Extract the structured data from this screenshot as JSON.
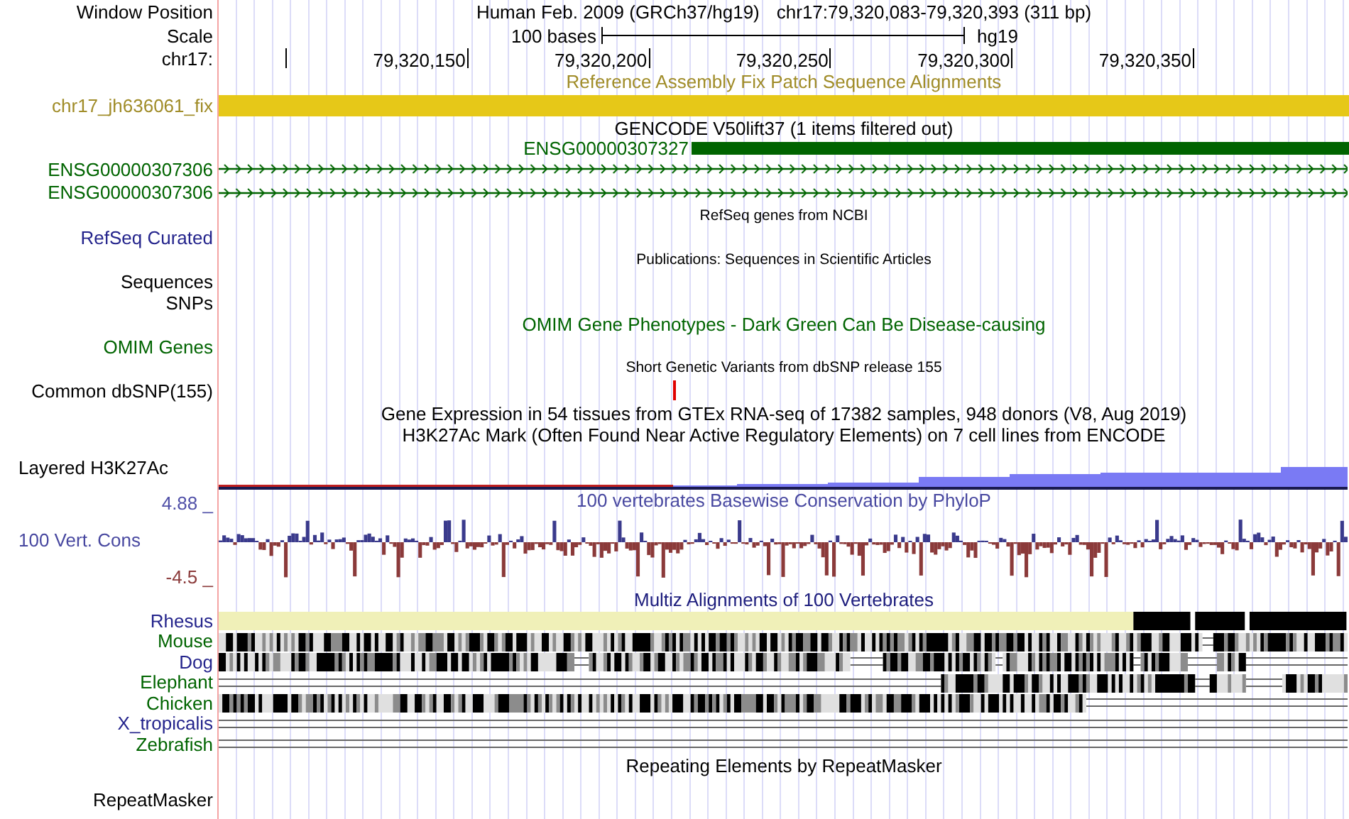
{
  "header": {
    "label": "Window Position",
    "assembly": "Human Feb. 2009 (GRCh37/hg19)",
    "position": "chr17:79,320,083-79,320,393 (311 bp)"
  },
  "scale": {
    "label": "Scale",
    "length": "100 bases",
    "assembly": "hg19"
  },
  "ruler": {
    "label": "chr17:",
    "ticks": [
      "79,320,150",
      "79,320,200",
      "79,320,250",
      "79,320,300",
      "79,320,350"
    ]
  },
  "tracks": [
    {
      "kind": "title",
      "text": "Reference Assembly Fix Patch Sequence Alignments",
      "color": "#a08c28"
    },
    {
      "kind": "fix_bar",
      "label": "chr17_jh636061_fix",
      "color": "#a08c28"
    },
    {
      "kind": "title",
      "text": "GENCODE V50lift37 (1 items filtered out)",
      "color": "#000000"
    },
    {
      "kind": "gene",
      "text": "ENSG00000307327",
      "color": "#006400"
    },
    {
      "kind": "arrows",
      "label": "ENSG00000307306",
      "color": "#006400"
    },
    {
      "kind": "arrows",
      "label": "ENSG00000307306",
      "color": "#006400"
    },
    {
      "kind": "note",
      "text": "RefSeq genes from NCBI",
      "color": "#000000"
    },
    {
      "kind": "label",
      "label": "RefSeq Curated",
      "color": "#24248c"
    },
    {
      "kind": "note",
      "text": "Publications: Sequences in Scientific Articles",
      "color": "#000000"
    },
    {
      "kind": "label",
      "label": "Sequences",
      "color": "#000000"
    },
    {
      "kind": "label",
      "label": "SNPs",
      "color": "#000000"
    },
    {
      "kind": "title",
      "text": "OMIM Gene Phenotypes - Dark Green Can Be Disease-causing",
      "color": "#006400"
    },
    {
      "kind": "label",
      "label": "OMIM Genes",
      "color": "#006400"
    },
    {
      "kind": "note",
      "text": "Short Genetic Variants from dbSNP release 155",
      "color": "#000000"
    },
    {
      "kind": "snp",
      "label": "Common dbSNP(155)",
      "color": "#000000"
    },
    {
      "kind": "title",
      "text": "Gene Expression in 54 tissues from GTEx RNA-seq of 17382 samples, 948 donors (V8, Aug 2019)",
      "color": "#000000"
    },
    {
      "kind": "title",
      "text": "H3K27Ac Mark (Often Found Near Active Regulatory Elements) on 7 cell lines from ENCODE",
      "color": "#000000"
    },
    {
      "kind": "layered",
      "label": "Layered H3K27Ac",
      "color": "#000000"
    },
    {
      "kind": "phylop",
      "label": "100 Vert. Cons",
      "max": "4.88 _",
      "min": "-4.5 _",
      "text": "100 vertebrates Basewise Conservation by PhyloP",
      "color": "#4848a0"
    },
    {
      "kind": "title",
      "text": "Multiz Alignments of 100 Vertebrates",
      "color": "#1c1c7c"
    },
    {
      "kind": "species",
      "label": "Rhesus",
      "color": "#24248c"
    },
    {
      "kind": "species",
      "label": "Mouse",
      "color": "#006400"
    },
    {
      "kind": "species",
      "label": "Dog",
      "color": "#24248c"
    },
    {
      "kind": "species",
      "label": "Elephant",
      "color": "#006400"
    },
    {
      "kind": "species",
      "label": "Chicken",
      "color": "#006400"
    },
    {
      "kind": "species",
      "label": "X_tropicalis",
      "color": "#24248c"
    },
    {
      "kind": "species",
      "label": "Zebrafish",
      "color": "#006400"
    },
    {
      "kind": "title",
      "text": "Repeating Elements by RepeatMasker",
      "color": "#000000"
    },
    {
      "kind": "label",
      "label": "RepeatMasker",
      "color": "#000000"
    }
  ]
}
